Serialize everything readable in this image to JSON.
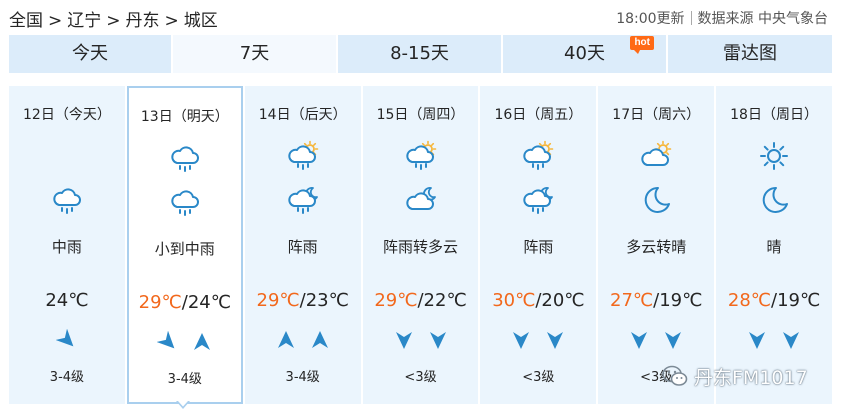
{
  "breadcrumb": {
    "items": [
      "全国",
      "辽宁",
      "丹东",
      "城区"
    ],
    "separator": ">"
  },
  "meta": {
    "update": "18:00更新",
    "source": "数据来源 中央气象台"
  },
  "tabs": [
    {
      "label": "今天",
      "active": false
    },
    {
      "label": "7天",
      "active": true
    },
    {
      "label": "8-15天",
      "active": false
    },
    {
      "label": "40天",
      "active": false,
      "badge": "hot"
    },
    {
      "label": "雷达图",
      "active": false
    }
  ],
  "colors": {
    "accent_temp": "#f2681c",
    "icon_blue": "#2a88c8",
    "sun_yellow": "#f6b63a",
    "tab_bg": "#dcecfa",
    "card_bg": "#ebf5fd"
  },
  "days": [
    {
      "date": "12日（今天）",
      "icons": [
        "rain-cloud-icon"
      ],
      "weather": "中雨",
      "temp_high": "",
      "temp_sep": "",
      "temp_low": "24℃",
      "winds": [
        "southeast-arrow"
      ],
      "level": "3-4级"
    },
    {
      "date": "13日（明天）",
      "icons": [
        "rain-cloud-icon",
        "rain-cloud-icon"
      ],
      "weather": "小到中雨",
      "temp_high": "29℃",
      "temp_sep": "/",
      "temp_low": "24℃",
      "winds": [
        "southeast-arrow",
        "north-arrow"
      ],
      "level": "3-4级"
    },
    {
      "date": "14日（后天）",
      "icons": [
        "sun-rain-cloud-icon",
        "moon-rain-cloud-icon"
      ],
      "weather": "阵雨",
      "temp_high": "29℃",
      "temp_sep": "/",
      "temp_low": "23℃",
      "winds": [
        "north-arrow",
        "north-arrow"
      ],
      "level": "3-4级"
    },
    {
      "date": "15日（周四）",
      "icons": [
        "sun-rain-cloud-icon",
        "moon-cloud-icon"
      ],
      "weather": "阵雨转多云",
      "temp_high": "29℃",
      "temp_sep": "/",
      "temp_low": "22℃",
      "winds": [
        "south-arrow",
        "south-arrow"
      ],
      "level": "<3级"
    },
    {
      "date": "16日（周五）",
      "icons": [
        "sun-rain-cloud-icon",
        "moon-rain-cloud-icon"
      ],
      "weather": "阵雨",
      "temp_high": "30℃",
      "temp_sep": "/",
      "temp_low": "20℃",
      "winds": [
        "south-arrow",
        "south-arrow"
      ],
      "level": "<3级"
    },
    {
      "date": "17日（周六）",
      "icons": [
        "sun-cloud-icon",
        "moon-icon"
      ],
      "weather": "多云转晴",
      "temp_high": "27℃",
      "temp_sep": "/",
      "temp_low": "19℃",
      "winds": [
        "south-arrow",
        "south-arrow"
      ],
      "level": "<3级"
    },
    {
      "date": "18日（周日）",
      "icons": [
        "sun-icon",
        "moon-icon"
      ],
      "weather": "晴",
      "temp_high": "28℃",
      "temp_sep": "/",
      "temp_low": "19℃",
      "winds": [
        "south-arrow",
        "south-arrow"
      ],
      "level": ""
    }
  ],
  "watermark": {
    "text": "丹东FM1017"
  }
}
